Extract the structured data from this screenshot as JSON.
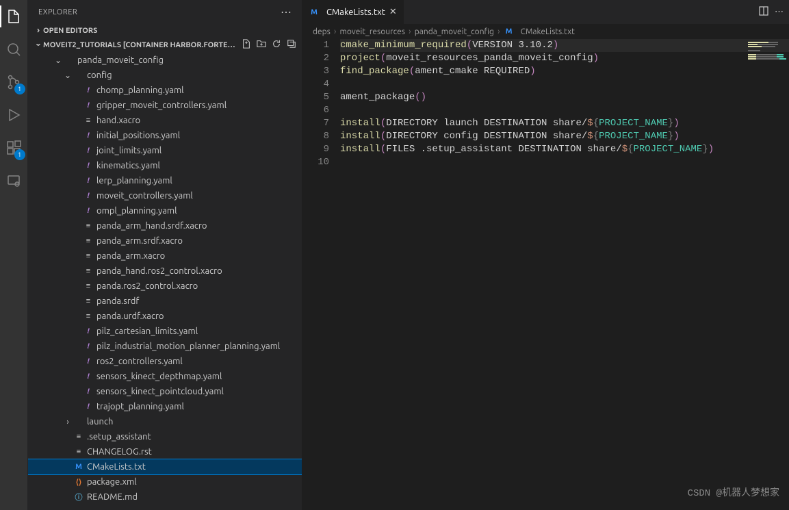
{
  "activity": {
    "badge_scm": "1",
    "badge_ext": "1"
  },
  "sidebar": {
    "title": "EXPLORER",
    "open_editors": "OPEN EDITORS",
    "workspace": "MOVEIT2_TUTORIALS [CONTAINER HARBOR.FORTE…",
    "folder_panda": "panda_moveit_config",
    "folder_config": "config",
    "folder_launch": "launch",
    "files_config": [
      {
        "n": "chomp_planning.yaml",
        "t": "yaml"
      },
      {
        "n": "gripper_moveit_controllers.yaml",
        "t": "yaml"
      },
      {
        "n": "hand.xacro",
        "t": "file"
      },
      {
        "n": "initial_positions.yaml",
        "t": "yaml"
      },
      {
        "n": "joint_limits.yaml",
        "t": "yaml"
      },
      {
        "n": "kinematics.yaml",
        "t": "yaml"
      },
      {
        "n": "lerp_planning.yaml",
        "t": "yaml"
      },
      {
        "n": "moveit_controllers.yaml",
        "t": "yaml"
      },
      {
        "n": "ompl_planning.yaml",
        "t": "yaml"
      },
      {
        "n": "panda_arm_hand.srdf.xacro",
        "t": "file"
      },
      {
        "n": "panda_arm.srdf.xacro",
        "t": "file"
      },
      {
        "n": "panda_arm.xacro",
        "t": "file"
      },
      {
        "n": "panda_hand.ros2_control.xacro",
        "t": "file"
      },
      {
        "n": "panda.ros2_control.xacro",
        "t": "file"
      },
      {
        "n": "panda.srdf",
        "t": "file"
      },
      {
        "n": "panda.urdf.xacro",
        "t": "file"
      },
      {
        "n": "pilz_cartesian_limits.yaml",
        "t": "yaml"
      },
      {
        "n": "pilz_industrial_motion_planner_planning.yaml",
        "t": "yaml"
      },
      {
        "n": "ros2_controllers.yaml",
        "t": "yaml"
      },
      {
        "n": "sensors_kinect_depthmap.yaml",
        "t": "yaml"
      },
      {
        "n": "sensors_kinect_pointcloud.yaml",
        "t": "yaml"
      },
      {
        "n": "trajopt_planning.yaml",
        "t": "yaml"
      }
    ],
    "files_root": [
      {
        "n": ".setup_assistant",
        "t": "file"
      },
      {
        "n": "CHANGELOG.rst",
        "t": "file"
      },
      {
        "n": "CMakeLists.txt",
        "t": "cmake",
        "selected": true
      },
      {
        "n": "package.xml",
        "t": "xml"
      },
      {
        "n": "README.md",
        "t": "md"
      }
    ]
  },
  "tab": {
    "name": "CMakeLists.txt"
  },
  "crumbs": [
    "deps",
    "moveit_resources",
    "panda_moveit_config",
    "CMakeLists.txt"
  ],
  "code": {
    "lines": [
      [
        {
          "c": "tk-fn",
          "t": "cmake_minimum_required"
        },
        {
          "c": "tk-paren",
          "t": "("
        },
        {
          "c": "",
          "t": "VERSION 3.10.2"
        },
        {
          "c": "tk-paren",
          "t": ")"
        }
      ],
      [
        {
          "c": "tk-fn",
          "t": "project"
        },
        {
          "c": "tk-paren",
          "t": "("
        },
        {
          "c": "",
          "t": "moveit_resources_panda_moveit_config"
        },
        {
          "c": "tk-paren",
          "t": ")"
        }
      ],
      [
        {
          "c": "tk-fn",
          "t": "find_package"
        },
        {
          "c": "tk-paren",
          "t": "("
        },
        {
          "c": "",
          "t": "ament_cmake REQUIRED"
        },
        {
          "c": "tk-paren",
          "t": ")"
        }
      ],
      [],
      [
        {
          "c": "",
          "t": "ament_package"
        },
        {
          "c": "tk-paren",
          "t": "("
        },
        {
          "c": "tk-paren",
          "t": ")"
        }
      ],
      [],
      [
        {
          "c": "tk-fn",
          "t": "install"
        },
        {
          "c": "tk-paren",
          "t": "("
        },
        {
          "c": "",
          "t": "DIRECTORY launch DESTINATION share/"
        },
        {
          "c": "tk-str",
          "t": "$"
        },
        {
          "c": "tk-brace",
          "t": "{"
        },
        {
          "c": "tk-var1",
          "t": "PROJECT_NAME"
        },
        {
          "c": "tk-brace",
          "t": "}"
        },
        {
          "c": "tk-paren",
          "t": ")"
        }
      ],
      [
        {
          "c": "tk-fn",
          "t": "install"
        },
        {
          "c": "tk-paren",
          "t": "("
        },
        {
          "c": "",
          "t": "DIRECTORY config DESTINATION share/"
        },
        {
          "c": "tk-str",
          "t": "$"
        },
        {
          "c": "tk-brace",
          "t": "{"
        },
        {
          "c": "tk-var1",
          "t": "PROJECT_NAME"
        },
        {
          "c": "tk-brace",
          "t": "}"
        },
        {
          "c": "tk-paren",
          "t": ")"
        }
      ],
      [
        {
          "c": "tk-fn",
          "t": "install"
        },
        {
          "c": "tk-paren",
          "t": "("
        },
        {
          "c": "",
          "t": "FILES .setup_assistant DESTINATION share/"
        },
        {
          "c": "tk-str",
          "t": "$"
        },
        {
          "c": "tk-brace",
          "t": "{"
        },
        {
          "c": "tk-var1",
          "t": "PROJECT_NAME"
        },
        {
          "c": "tk-brace",
          "t": "}"
        },
        {
          "c": "tk-paren",
          "t": ")"
        }
      ],
      []
    ]
  },
  "watermark": "CSDN @机器人梦想家"
}
